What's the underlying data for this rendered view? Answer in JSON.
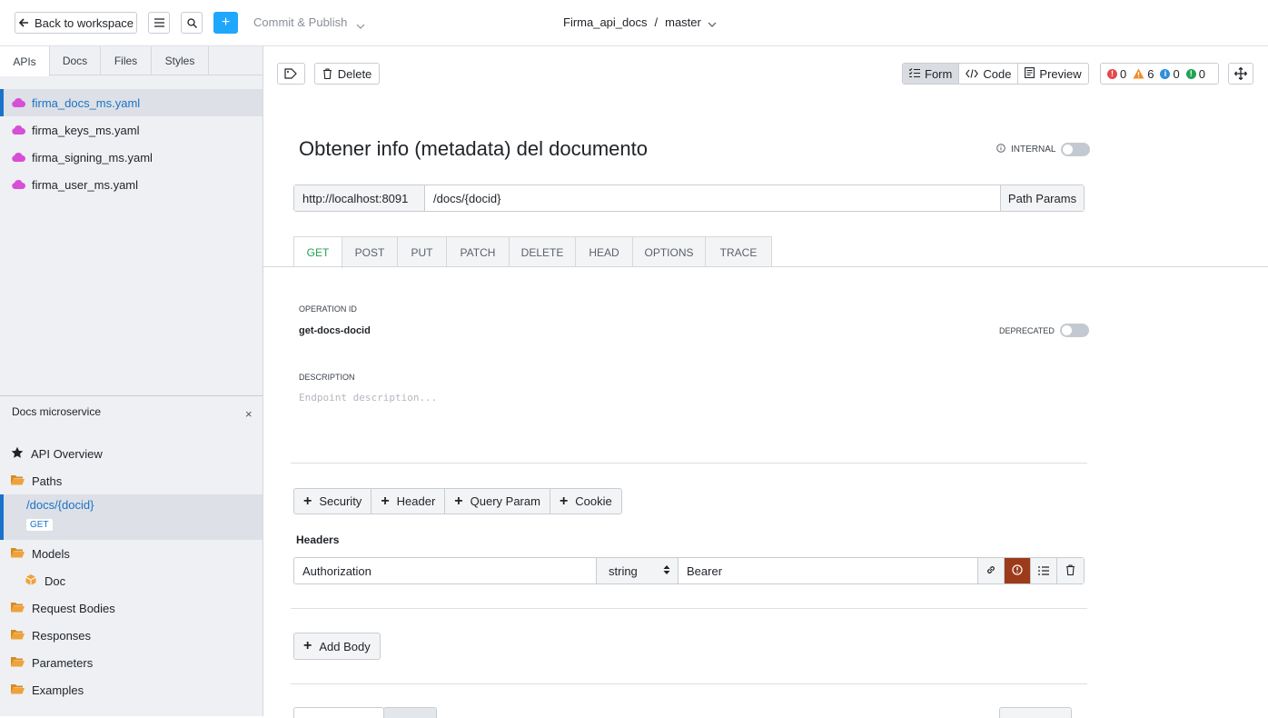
{
  "topbar": {
    "back_label": "Back to workspace",
    "plus_label": "+",
    "commit_label": "Commit & Publish",
    "project_name": "Firma_api_docs",
    "separator": "/",
    "branch": "master"
  },
  "sidebar": {
    "tabs": [
      {
        "label": "APIs"
      },
      {
        "label": "Docs"
      },
      {
        "label": "Files"
      },
      {
        "label": "Styles"
      }
    ],
    "files": [
      {
        "label": "firma_docs_ms.yaml"
      },
      {
        "label": "firma_keys_ms.yaml"
      },
      {
        "label": "firma_signing_ms.yaml"
      },
      {
        "label": "firma_user_ms.yaml"
      }
    ],
    "panel": {
      "title": "Docs microservice",
      "close": "×",
      "overview": "API Overview",
      "paths": "Paths",
      "path_item": "/docs/{docid}",
      "path_method": "GET",
      "models": "Models",
      "model_doc": "Doc",
      "request_bodies": "Request Bodies",
      "responses": "Responses",
      "parameters": "Parameters",
      "examples": "Examples"
    }
  },
  "toolbar": {
    "delete_label": "Delete",
    "views": [
      {
        "label": "Form"
      },
      {
        "label": "Code"
      },
      {
        "label": "Preview"
      }
    ],
    "diagnostics": {
      "errors": "0",
      "warnings": "6",
      "info": "0",
      "hints": "0"
    }
  },
  "operation": {
    "title": "Obtener info (metadata) del documento",
    "internal_label": "INTERNAL",
    "host": "http://localhost:8091",
    "path": "/docs/{docid}",
    "path_params_label": "Path Params",
    "methods": [
      {
        "label": "GET"
      },
      {
        "label": "POST"
      },
      {
        "label": "PUT"
      },
      {
        "label": "PATCH"
      },
      {
        "label": "DELETE"
      },
      {
        "label": "HEAD"
      },
      {
        "label": "OPTIONS"
      },
      {
        "label": "TRACE"
      }
    ],
    "operation_id_label": "OPERATION ID",
    "operation_id": "get-docs-docid",
    "deprecated_label": "DEPRECATED",
    "description_label": "DESCRIPTION",
    "description_placeholder": "Endpoint description..."
  },
  "params": {
    "add_buttons": [
      {
        "label": "Security"
      },
      {
        "label": "Header"
      },
      {
        "label": "Query Param"
      },
      {
        "label": "Cookie"
      }
    ],
    "headers_label": "Headers",
    "header": {
      "name": "Authorization",
      "type": "string",
      "value": "Bearer"
    }
  },
  "body": {
    "add_label": "Add Body"
  },
  "colors": {
    "accent": "#1a73c8",
    "primary_button": "#1ea7fd",
    "get_green": "#22a355",
    "required": "#9b3b1a",
    "error": "#e5484d",
    "warning": "#f08c2b",
    "info": "#2f8fd8",
    "hint": "#22a355",
    "file_icon": "#d64fd6",
    "folder_icon": "#f0a23a"
  },
  "icons": [
    "arrow-left-icon",
    "list-icon",
    "search-icon",
    "chevron-down-icon",
    "cloud-icon",
    "star-icon",
    "folder-icon",
    "cube-icon",
    "tag-icon",
    "trash-icon",
    "form-icon",
    "code-icon",
    "preview-icon",
    "move-icon",
    "info-icon",
    "link-icon",
    "required-icon",
    "list-options-icon",
    "close-icon"
  ]
}
